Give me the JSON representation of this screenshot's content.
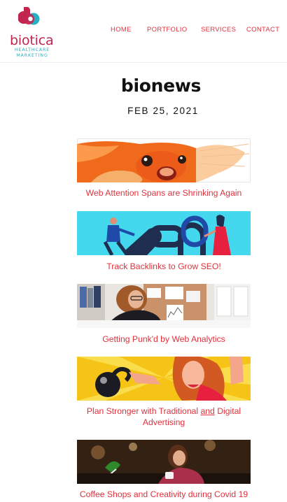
{
  "brand": {
    "name": "biotica",
    "tagline_line1": "HEALTHCARE",
    "tagline_line2": "MARKETING",
    "colors": {
      "primary": "#c1264f",
      "secondary": "#26b0c4",
      "link": "#e0313d"
    }
  },
  "nav": {
    "home": "HOME",
    "portfolio": "PORTFOLIO",
    "services": "SERVICES",
    "contact": "CONTACT"
  },
  "page": {
    "title": "bionews",
    "date": "FEB 25, 2021"
  },
  "posts": [
    {
      "title": "Web Attention Spans are Shrinking Again",
      "image": "goldfish-image"
    },
    {
      "title": "Track Backlinks to Grow SEO!",
      "image": "chain-links-image"
    },
    {
      "title": "Getting Punk'd by Web Analytics",
      "image": "office-woman-image"
    },
    {
      "title_part1": "Plan Stronger with Traditional ",
      "title_underlined": "and",
      "title_part2": " Digital Advertising",
      "image": "pop-art-kettlebell-image"
    },
    {
      "title": "Coffee Shops and Creativity during Covid 19",
      "image": "coffee-shop-image"
    }
  ]
}
